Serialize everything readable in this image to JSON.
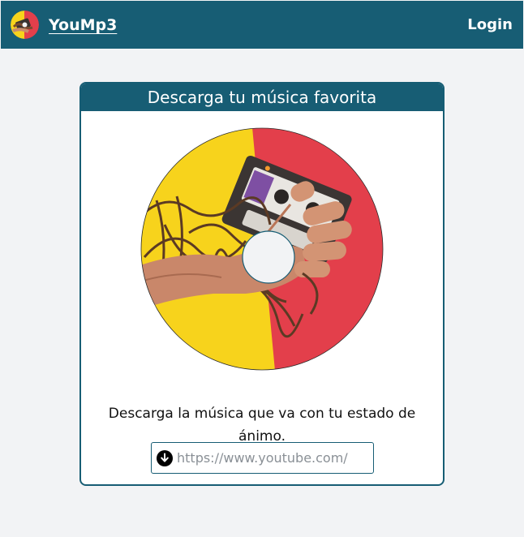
{
  "navbar": {
    "brand_name": "YouMp3",
    "login_label": "Login"
  },
  "card": {
    "title": "Descarga tu música favorita",
    "tagline": "Descarga la música que va con tu estado de ánimo.",
    "url_input": {
      "placeholder": "https://www.youtube.com/",
      "value": ""
    }
  },
  "colors": {
    "primary": "#175d74",
    "background": "#f2f3f5",
    "disc_yellow": "#f7d31c",
    "disc_red": "#e33f4b"
  },
  "icons": {
    "logo": "cassette-disc-logo",
    "download": "download-arrow-icon"
  }
}
